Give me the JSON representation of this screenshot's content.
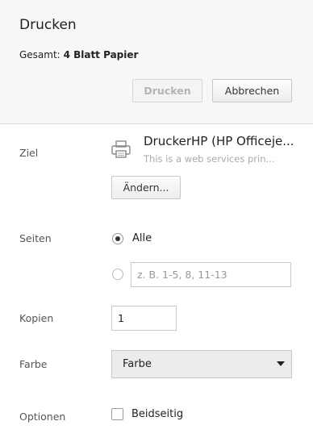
{
  "header": {
    "title": "Drucken",
    "summary_label": "Gesamt:",
    "summary_value": "4 Blatt Papier",
    "print_button": "Drucken",
    "cancel_button": "Abbrechen"
  },
  "destination": {
    "label": "Ziel",
    "icon": "printer-icon",
    "name": "DruckerHP (HP Officeje...",
    "description": "This is a web services prin...",
    "change_button": "Ändern..."
  },
  "pages": {
    "label": "Seiten",
    "option_all": "Alle",
    "option_all_selected": true,
    "custom_placeholder": "z. B. 1-5, 8, 11-13"
  },
  "copies": {
    "label": "Kopien",
    "value": "1"
  },
  "color": {
    "label": "Farbe",
    "selected": "Farbe"
  },
  "options": {
    "label": "Optionen",
    "duplex_label": "Beidseitig",
    "duplex_checked": false
  }
}
